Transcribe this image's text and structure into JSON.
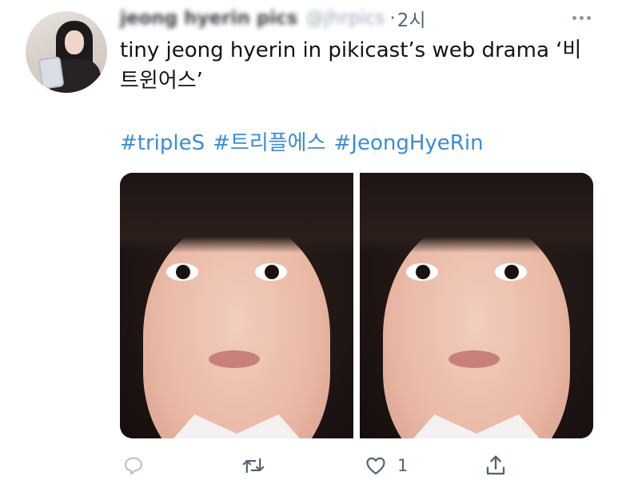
{
  "tweet": {
    "author_name": "jeong hyerin pics",
    "handle": "@jhrpics",
    "separator": "·",
    "time": "2시",
    "text": "tiny jeong hyerin in pikicast’s web drama ‘비트윈어스’",
    "hashtags": [
      "#tripleS",
      "#트리플에스",
      "#JeongHyeRin"
    ],
    "like_count": "1"
  },
  "icons": {
    "more": "more-horizontal-icon",
    "reply": "reply-icon",
    "retweet": "retweet-icon",
    "like": "heart-icon",
    "share": "share-icon"
  },
  "colors": {
    "text": "#0f1419",
    "muted": "#536471",
    "hashtag": "#3b8dd5"
  }
}
